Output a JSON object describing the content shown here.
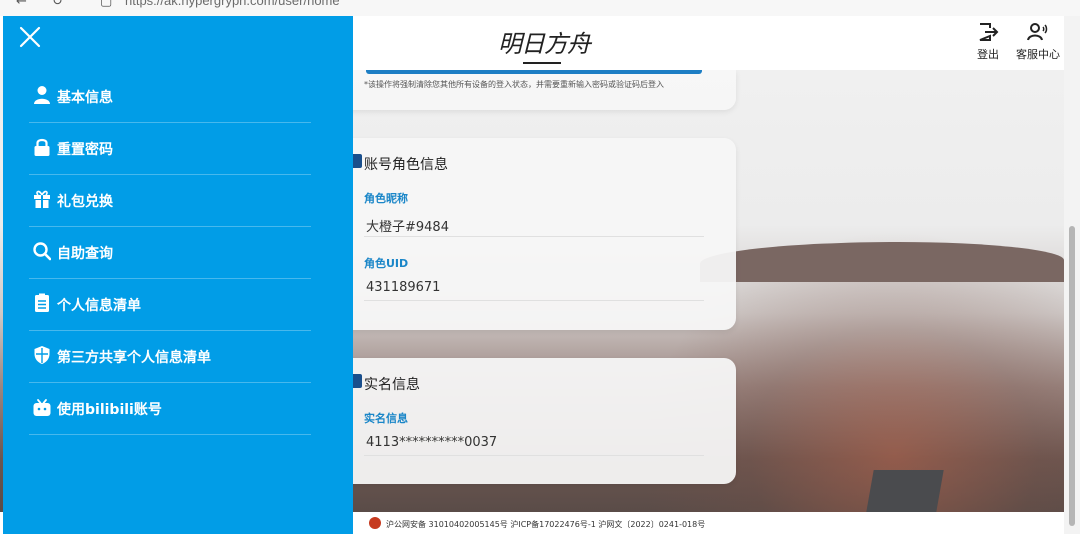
{
  "browser": {
    "url": "https://ak.hypergryph.com/user/home"
  },
  "header": {
    "logo": "明日方舟",
    "logout_label": "登出",
    "support_label": "客服中心"
  },
  "security_card": {
    "note": "*该操作将强制清除您其他所有设备的登入状态，并需要重新输入密码或验证码后登入"
  },
  "role_card": {
    "title": "账号角色信息",
    "nickname_label": "角色昵称",
    "nickname_value": "大橙子#9484",
    "uid_label": "角色UID",
    "uid_value": "431189671"
  },
  "realname_card": {
    "title": "实名信息",
    "field_label": "实名信息",
    "field_value": "4113**********0037"
  },
  "footer": {
    "text": "沪公网安备 31010402005145号  沪ICP备17022476号-1  沪网文〔2022〕0241-018号"
  },
  "sidebar": {
    "items": [
      {
        "label": "基本信息",
        "icon": "user-icon"
      },
      {
        "label": "重置密码",
        "icon": "lock-icon"
      },
      {
        "label": "礼包兑换",
        "icon": "gift-icon"
      },
      {
        "label": "自助查询",
        "icon": "search-icon"
      },
      {
        "label": "个人信息清单",
        "icon": "clipboard-icon"
      },
      {
        "label": "第三方共享个人信息清单",
        "icon": "shield-icon"
      },
      {
        "label": "使用bilibili账号",
        "icon": "bilibili-icon"
      }
    ]
  },
  "colors": {
    "sidebar_bg": "#019de7",
    "accent_label": "#1a86c8"
  }
}
